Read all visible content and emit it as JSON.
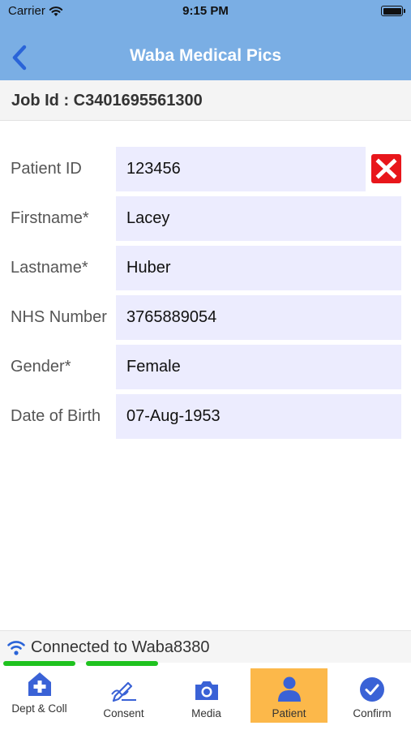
{
  "status_bar": {
    "carrier": "Carrier",
    "time": "9:15 PM"
  },
  "header": {
    "title": "Waba Medical Pics"
  },
  "job": {
    "text": "Job Id : C3401695561300"
  },
  "form": {
    "fields": [
      {
        "label": "Patient ID",
        "value": "123456"
      },
      {
        "label": "Firstname*",
        "value": "Lacey"
      },
      {
        "label": "Lastname*",
        "value": "Huber"
      },
      {
        "label": "NHS Number",
        "value": "3765889054"
      },
      {
        "label": "Gender*",
        "value": "Female"
      },
      {
        "label": "Date of Birth",
        "value": "07-Aug-1953"
      }
    ]
  },
  "connection": {
    "text": "Connected to Waba8380"
  },
  "tabs": [
    {
      "label": "Dept & Coll",
      "icon": "hospital-icon"
    },
    {
      "label": "Consent",
      "icon": "signature-icon"
    },
    {
      "label": "Media",
      "icon": "camera-icon"
    },
    {
      "label": "Patient",
      "icon": "person-icon",
      "active": true
    },
    {
      "label": "Confirm",
      "icon": "check-circle-icon"
    }
  ],
  "colors": {
    "header": "#7aaee4",
    "field_bg": "#ececfe",
    "active_tab": "#fcb84a",
    "icon_blue": "#3a62d6",
    "clear_red": "#e8161b",
    "signal_green": "#1fc21f"
  }
}
